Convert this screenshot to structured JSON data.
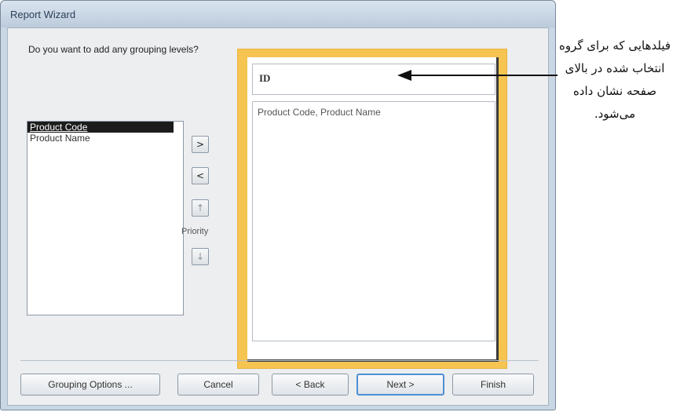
{
  "window": {
    "title": "Report Wizard"
  },
  "question": "Do you want to add any grouping levels?",
  "available_fields": [
    {
      "label": "Product Code",
      "selected": true
    },
    {
      "label": "Product Name",
      "selected": false
    }
  ],
  "move_buttons": {
    "add": ">",
    "remove": "<",
    "priority_up": "↑",
    "priority_down": "↓",
    "priority_label": "Priority"
  },
  "preview": {
    "group_field": "ID",
    "detail_fields": "Product Code, Product Name"
  },
  "buttons": {
    "grouping_options": "Grouping Options ...",
    "cancel": "Cancel",
    "back": "< Back",
    "next": "Next >",
    "finish": "Finish"
  },
  "annotation": {
    "text": "فیلدهایی که برای گروه انتخاب شده در بالای صفحه نشان داده می‌شود."
  },
  "colors": {
    "preview_frame": "#f5c451",
    "selection": "#1c1c1c",
    "default_button_border": "#4d8fd4"
  }
}
